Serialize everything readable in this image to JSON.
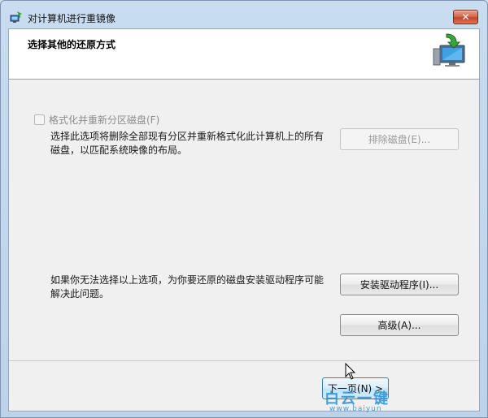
{
  "window": {
    "title": "对计算机进行重镜像",
    "close_label": "✕"
  },
  "header": {
    "title": "选择其他的还原方式",
    "icon": "computer-restore-icon"
  },
  "options": {
    "format_checkbox_label": "格式化并重新分区磁盘(F)",
    "format_checked": false,
    "format_desc_line1": "选择此选项将删除全部现有分区并重新格式化此计算机上的所有",
    "format_desc_line2": "磁盘，以匹配系统映像的布局。",
    "exclude_disks_label": "排除磁盘(E)...",
    "driver_desc_line1": "如果你无法选择以上选项，为你要还原的磁盘安装驱动程序可能",
    "driver_desc_line2": "解决此问题。",
    "install_driver_label": "安装驱动程序(I)...",
    "advanced_label": "高级(A)..."
  },
  "footer": {
    "next_label": "下一页(N) >"
  },
  "watermark": {
    "text": "白云一键",
    "sub": "www.baiyun"
  },
  "colors": {
    "frame": "#c9dcf0",
    "close": "#c2462b",
    "next_border": "#3c7fb1"
  }
}
